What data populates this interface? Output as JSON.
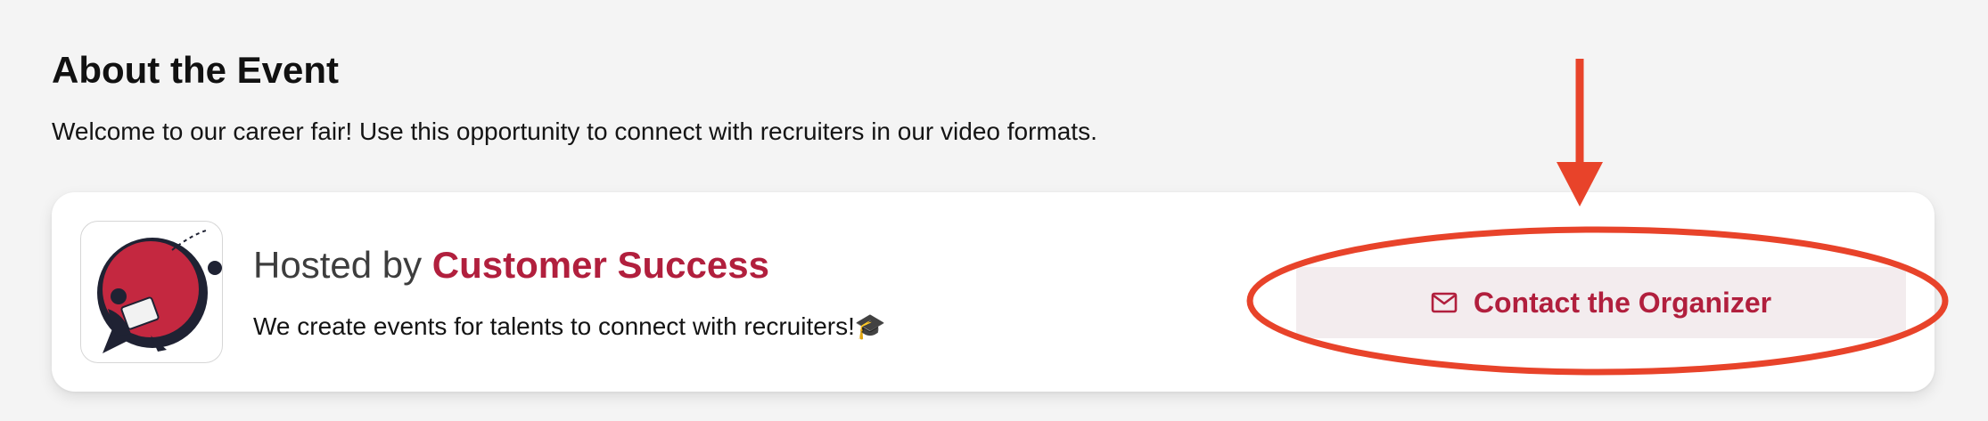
{
  "section": {
    "title": "About the Event",
    "description": "Welcome to our career fair! Use this opportunity to connect with recruiters in our video formats."
  },
  "host_card": {
    "hosted_by_prefix": "Hosted by ",
    "host_name": "Customer Success",
    "tagline": "We create events for talents to connect with recruiters!",
    "tagline_emoji": "🎓",
    "avatar_icon": "chat-bubble-illustration-icon",
    "contact_button": {
      "label": "Contact the Organizer",
      "icon": "mail-icon"
    }
  },
  "annotation": {
    "arrow_icon": "down-arrow-icon",
    "highlight": "ellipse-highlight",
    "color": "#e8432a"
  },
  "colors": {
    "page_background": "#f4f4f4",
    "card_background": "#ffffff",
    "brand_accent": "#b11f3d",
    "button_background": "#f3ecee",
    "annotation_red": "#e8432a"
  }
}
